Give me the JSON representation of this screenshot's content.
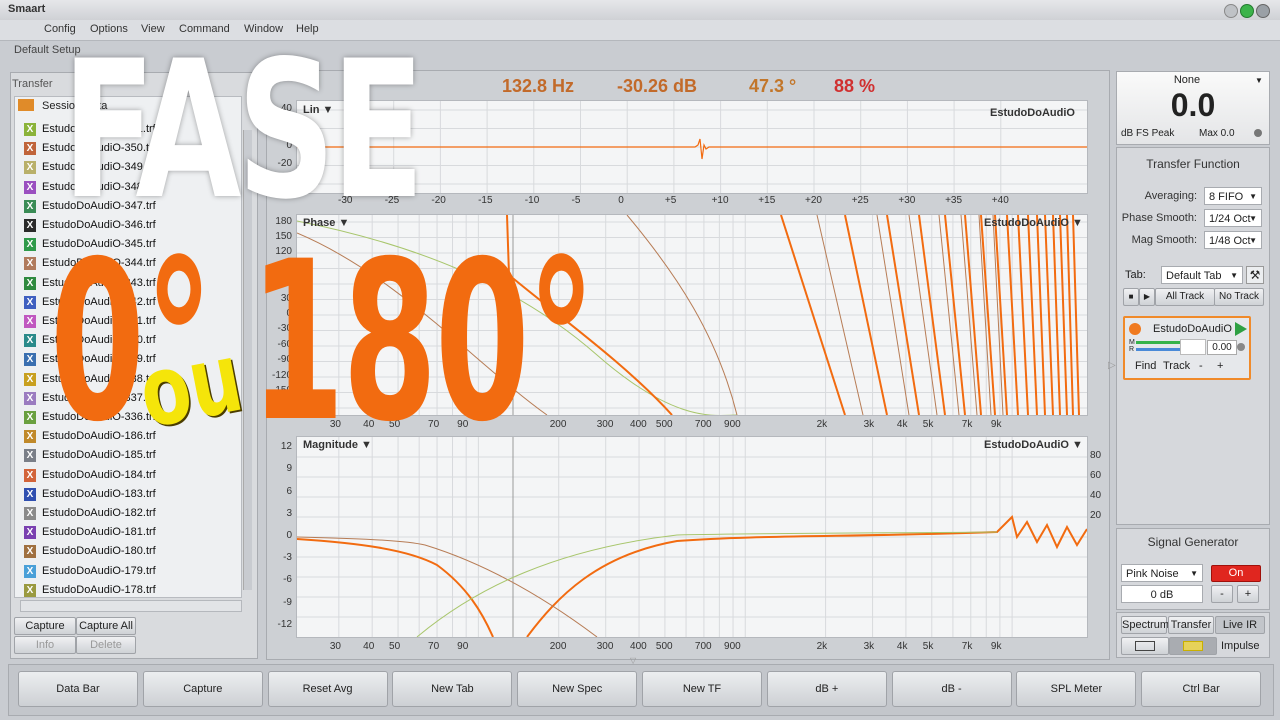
{
  "window": {
    "title": "Smaart",
    "default_setup": "Default Setup"
  },
  "menu": [
    "Config",
    "Options",
    "View",
    "Command",
    "Window",
    "Help"
  ],
  "left_panel": {
    "header": "Transfer",
    "folder": "Session Data",
    "files": [
      {
        "name": "EstudoDoAudiO-351.trf",
        "color": "#8bb33a"
      },
      {
        "name": "EstudoDoAudiO-350.trf",
        "color": "#c0643a"
      },
      {
        "name": "EstudoDoAudiO-349.trf",
        "color": "#b9b06a"
      },
      {
        "name": "EstudoDoAudiO-348.trf",
        "color": "#9a4fc0"
      },
      {
        "name": "EstudoDoAudiO-347.trf",
        "color": "#3a8c56"
      },
      {
        "name": "EstudoDoAudiO-346.trf",
        "color": "#2b2b2b"
      },
      {
        "name": "EstudoDoAudiO-345.trf",
        "color": "#2f9a4a"
      },
      {
        "name": "EstudoDoAudiO-344.trf",
        "color": "#b07a5c"
      },
      {
        "name": "EstudoDoAudiO-343.trf",
        "color": "#2f8a3f"
      },
      {
        "name": "EstudoDoAudiO-342.trf",
        "color": "#3f5fc0"
      },
      {
        "name": "EstudoDoAudiO-341.trf",
        "color": "#c058c0"
      },
      {
        "name": "EstudoDoAudiO-340.trf",
        "color": "#2a8a8a"
      },
      {
        "name": "EstudoDoAudiO-339.trf",
        "color": "#3a6fb0"
      },
      {
        "name": "EstudoDoAudiO-338.trf",
        "color": "#c8a020"
      },
      {
        "name": "EstudoDoAudiO-337.trf",
        "color": "#9b7cc0"
      },
      {
        "name": "EstudoDoAudiO-336.trf",
        "color": "#6aa040"
      },
      {
        "name": "EstudoDoAudiO-186.trf",
        "color": "#c0892a"
      },
      {
        "name": "EstudoDoAudiO-185.trf",
        "color": "#7a7f88"
      },
      {
        "name": "EstudoDoAudiO-184.trf",
        "color": "#d2643a"
      },
      {
        "name": "EstudoDoAudiO-183.trf",
        "color": "#2f4fb0"
      },
      {
        "name": "EstudoDoAudiO-182.trf",
        "color": "#8a8a8a"
      },
      {
        "name": "EstudoDoAudiO-181.trf",
        "color": "#7a40b0"
      },
      {
        "name": "EstudoDoAudiO-180.trf",
        "color": "#a07040"
      },
      {
        "name": "EstudoDoAudiO-179.trf",
        "color": "#4aa0d8"
      },
      {
        "name": "EstudoDoAudiO-178.trf",
        "color": "#9a9a40"
      }
    ],
    "buttons": [
      "Capture",
      "Capture All",
      "Info",
      "Delete"
    ]
  },
  "readout": {
    "freq": "132.8 Hz",
    "db": "-30.26 dB",
    "deg": "47.3 °",
    "pct": "88 %"
  },
  "plots": {
    "lin": {
      "label": "Lin ▼",
      "trace_name": "EstudoDoAudiO",
      "y_ticks": [
        "40",
        "20",
        "0",
        "-20",
        "-40"
      ],
      "x_ticks": [
        "-30",
        "-25",
        "-20",
        "-15",
        "-10",
        "-5",
        "0",
        "+5",
        "+10",
        "+15",
        "+20",
        "+25",
        "+30",
        "+35",
        "+40"
      ]
    },
    "phase": {
      "label": "Phase ▼",
      "trace_name": "EstudoDoAudiO ▼",
      "y_ticks": [
        "180",
        "150",
        "120",
        "90",
        "60",
        "30",
        "0",
        "-30",
        "-60",
        "-90",
        "-120",
        "-150",
        "-180"
      ]
    },
    "magnitude": {
      "label": "Magnitude ▼",
      "trace_name": "EstudoDoAudiO ▼",
      "y_ticks": [
        "12",
        "9",
        "6",
        "3",
        "0",
        "-3",
        "-6",
        "-9",
        "-12"
      ],
      "y2_ticks": [
        "80",
        "60",
        "40",
        "20"
      ]
    },
    "freq_ticks": [
      "30",
      "40",
      "50",
      "70",
      "90",
      "200",
      "300",
      "400",
      "500",
      "700",
      "900",
      "2k",
      "3k",
      "4k",
      "5k",
      "7k",
      "9k"
    ]
  },
  "meter": {
    "source": "None",
    "value": "0.0",
    "mode": "dB FS Peak",
    "max": "Max 0.0"
  },
  "transfer_function": {
    "title": "Transfer Function",
    "averaging_label": "Averaging:",
    "averaging": "8 FIFO",
    "phase_smooth_label": "Phase Smooth:",
    "phase_smooth": "1/24 Oct",
    "mag_smooth_label": "Mag Smooth:",
    "mag_smooth": "1/48 Oct",
    "tab_label": "Tab:",
    "tab": "Default Tab",
    "all_track": "All Track",
    "no_track": "No Track",
    "measurement": {
      "name": "EstudoDoAudiO",
      "delay": "0.00",
      "find": "Find",
      "track": "Track",
      "minus": "-",
      "plus": "+",
      "m_label": "M",
      "r_label": "R"
    }
  },
  "signal_generator": {
    "title": "Signal Generator",
    "type": "Pink Noise",
    "state": "On",
    "level": "0 dB",
    "minus": "-",
    "plus": "+"
  },
  "mode_tabs": [
    "Spectrum",
    "Transfer",
    "Live IR"
  ],
  "impulse_label": "Impulse",
  "bottom_buttons": [
    "Data Bar",
    "Capture",
    "Reset Avg",
    "New Tab",
    "New Spec",
    "New TF",
    "dB +",
    "dB -",
    "SPL Meter",
    "Ctrl Bar"
  ],
  "overlay": {
    "line1": "FASE",
    "zero": "0°",
    "or": "ou",
    "one_eighty": "180°"
  },
  "colors": {
    "accent_orange": "#f26b10",
    "overlay_yellow": "#f5e50a",
    "trace_green": "#a8c66c",
    "trace_brown": "#b77c55"
  }
}
